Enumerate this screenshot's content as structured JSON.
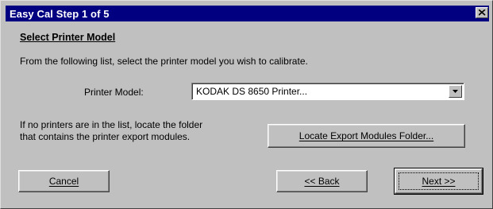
{
  "window": {
    "title": "Easy Cal Step 1 of 5"
  },
  "dialog": {
    "heading": "Select Printer Model",
    "instructions": "From the following list, select the printer model you wish to calibrate.",
    "printer_model_label": "Printer Model:",
    "printer_model_value": "KODAK DS 8650 Printer...",
    "locate_text_line1": "If no printers are in the list, locate the folder",
    "locate_text_line2": "that contains the printer export modules."
  },
  "buttons": {
    "locate": "Locate Export Modules Folder...",
    "cancel": "Cancel",
    "back": "<< Back",
    "next": "Next >>"
  },
  "icons": {
    "close": "close-icon",
    "dropdown": "chevron-down-icon"
  },
  "colors": {
    "titlebar": "#000080",
    "face": "#c0c0c0"
  }
}
